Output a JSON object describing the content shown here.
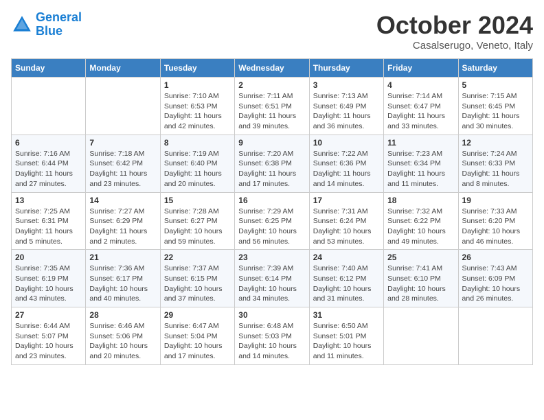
{
  "header": {
    "logo_line1": "General",
    "logo_line2": "Blue",
    "month": "October 2024",
    "location": "Casalserugo, Veneto, Italy"
  },
  "days_of_week": [
    "Sunday",
    "Monday",
    "Tuesday",
    "Wednesday",
    "Thursday",
    "Friday",
    "Saturday"
  ],
  "weeks": [
    [
      {
        "day": "",
        "info": ""
      },
      {
        "day": "",
        "info": ""
      },
      {
        "day": "1",
        "info": "Sunrise: 7:10 AM\nSunset: 6:53 PM\nDaylight: 11 hours and 42 minutes."
      },
      {
        "day": "2",
        "info": "Sunrise: 7:11 AM\nSunset: 6:51 PM\nDaylight: 11 hours and 39 minutes."
      },
      {
        "day": "3",
        "info": "Sunrise: 7:13 AM\nSunset: 6:49 PM\nDaylight: 11 hours and 36 minutes."
      },
      {
        "day": "4",
        "info": "Sunrise: 7:14 AM\nSunset: 6:47 PM\nDaylight: 11 hours and 33 minutes."
      },
      {
        "day": "5",
        "info": "Sunrise: 7:15 AM\nSunset: 6:45 PM\nDaylight: 11 hours and 30 minutes."
      }
    ],
    [
      {
        "day": "6",
        "info": "Sunrise: 7:16 AM\nSunset: 6:44 PM\nDaylight: 11 hours and 27 minutes."
      },
      {
        "day": "7",
        "info": "Sunrise: 7:18 AM\nSunset: 6:42 PM\nDaylight: 11 hours and 23 minutes."
      },
      {
        "day": "8",
        "info": "Sunrise: 7:19 AM\nSunset: 6:40 PM\nDaylight: 11 hours and 20 minutes."
      },
      {
        "day": "9",
        "info": "Sunrise: 7:20 AM\nSunset: 6:38 PM\nDaylight: 11 hours and 17 minutes."
      },
      {
        "day": "10",
        "info": "Sunrise: 7:22 AM\nSunset: 6:36 PM\nDaylight: 11 hours and 14 minutes."
      },
      {
        "day": "11",
        "info": "Sunrise: 7:23 AM\nSunset: 6:34 PM\nDaylight: 11 hours and 11 minutes."
      },
      {
        "day": "12",
        "info": "Sunrise: 7:24 AM\nSunset: 6:33 PM\nDaylight: 11 hours and 8 minutes."
      }
    ],
    [
      {
        "day": "13",
        "info": "Sunrise: 7:25 AM\nSunset: 6:31 PM\nDaylight: 11 hours and 5 minutes."
      },
      {
        "day": "14",
        "info": "Sunrise: 7:27 AM\nSunset: 6:29 PM\nDaylight: 11 hours and 2 minutes."
      },
      {
        "day": "15",
        "info": "Sunrise: 7:28 AM\nSunset: 6:27 PM\nDaylight: 10 hours and 59 minutes."
      },
      {
        "day": "16",
        "info": "Sunrise: 7:29 AM\nSunset: 6:25 PM\nDaylight: 10 hours and 56 minutes."
      },
      {
        "day": "17",
        "info": "Sunrise: 7:31 AM\nSunset: 6:24 PM\nDaylight: 10 hours and 53 minutes."
      },
      {
        "day": "18",
        "info": "Sunrise: 7:32 AM\nSunset: 6:22 PM\nDaylight: 10 hours and 49 minutes."
      },
      {
        "day": "19",
        "info": "Sunrise: 7:33 AM\nSunset: 6:20 PM\nDaylight: 10 hours and 46 minutes."
      }
    ],
    [
      {
        "day": "20",
        "info": "Sunrise: 7:35 AM\nSunset: 6:19 PM\nDaylight: 10 hours and 43 minutes."
      },
      {
        "day": "21",
        "info": "Sunrise: 7:36 AM\nSunset: 6:17 PM\nDaylight: 10 hours and 40 minutes."
      },
      {
        "day": "22",
        "info": "Sunrise: 7:37 AM\nSunset: 6:15 PM\nDaylight: 10 hours and 37 minutes."
      },
      {
        "day": "23",
        "info": "Sunrise: 7:39 AM\nSunset: 6:14 PM\nDaylight: 10 hours and 34 minutes."
      },
      {
        "day": "24",
        "info": "Sunrise: 7:40 AM\nSunset: 6:12 PM\nDaylight: 10 hours and 31 minutes."
      },
      {
        "day": "25",
        "info": "Sunrise: 7:41 AM\nSunset: 6:10 PM\nDaylight: 10 hours and 28 minutes."
      },
      {
        "day": "26",
        "info": "Sunrise: 7:43 AM\nSunset: 6:09 PM\nDaylight: 10 hours and 26 minutes."
      }
    ],
    [
      {
        "day": "27",
        "info": "Sunrise: 6:44 AM\nSunset: 5:07 PM\nDaylight: 10 hours and 23 minutes."
      },
      {
        "day": "28",
        "info": "Sunrise: 6:46 AM\nSunset: 5:06 PM\nDaylight: 10 hours and 20 minutes."
      },
      {
        "day": "29",
        "info": "Sunrise: 6:47 AM\nSunset: 5:04 PM\nDaylight: 10 hours and 17 minutes."
      },
      {
        "day": "30",
        "info": "Sunrise: 6:48 AM\nSunset: 5:03 PM\nDaylight: 10 hours and 14 minutes."
      },
      {
        "day": "31",
        "info": "Sunrise: 6:50 AM\nSunset: 5:01 PM\nDaylight: 10 hours and 11 minutes."
      },
      {
        "day": "",
        "info": ""
      },
      {
        "day": "",
        "info": ""
      }
    ]
  ]
}
